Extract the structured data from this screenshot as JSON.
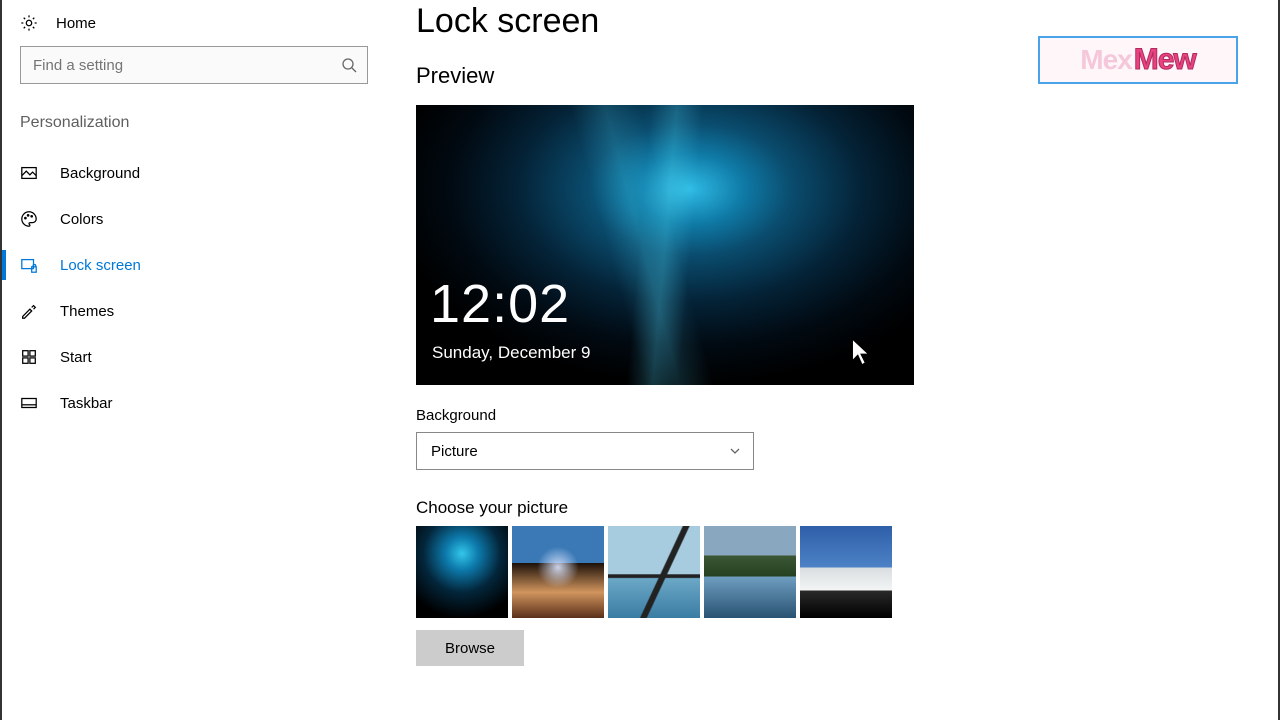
{
  "sidebar": {
    "home_label": "Home",
    "search_placeholder": "Find a setting",
    "section_title": "Personalization",
    "items": [
      {
        "label": "Background"
      },
      {
        "label": "Colors"
      },
      {
        "label": "Lock screen"
      },
      {
        "label": "Themes"
      },
      {
        "label": "Start"
      },
      {
        "label": "Taskbar"
      }
    ]
  },
  "main": {
    "title": "Lock screen",
    "preview_label": "Preview",
    "preview_time": "12:02",
    "preview_date": "Sunday, December 9",
    "background_label": "Background",
    "background_value": "Picture",
    "choose_label": "Choose your picture",
    "browse_label": "Browse"
  },
  "watermark": {
    "part1": "Mex",
    "part2": "Mew"
  }
}
